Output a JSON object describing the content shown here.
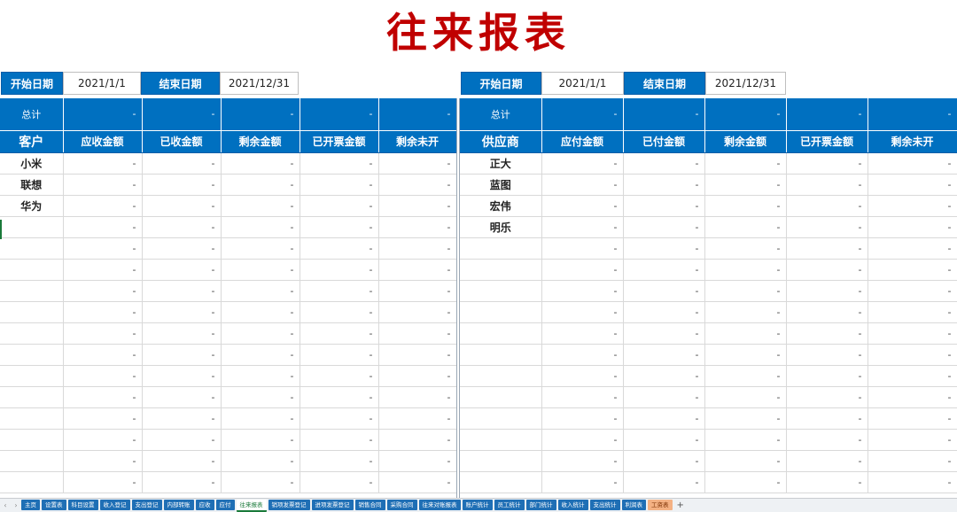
{
  "title": "往来报表",
  "left": {
    "start_label": "开始日期",
    "start_value": "2021/1/1",
    "end_label": "结束日期",
    "end_value": "2021/12/31",
    "total_label": "总计",
    "totals": [
      "-",
      "-",
      "-",
      "-",
      "-"
    ],
    "headers": [
      "客户",
      "应收金额",
      "已收金额",
      "剩余金额",
      "已开票金额",
      "剩余未开"
    ],
    "names": [
      "小米",
      "联想",
      "华为",
      "",
      "",
      "",
      "",
      "",
      "",
      "",
      "",
      "",
      "",
      "",
      "",
      ""
    ],
    "row_values": [
      "-",
      "-",
      "-",
      "-",
      "-"
    ]
  },
  "right": {
    "start_label": "开始日期",
    "start_value": "2021/1/1",
    "end_label": "结束日期",
    "end_value": "2021/12/31",
    "total_label": "总计",
    "totals": [
      "-",
      "-",
      "-",
      "-",
      "-"
    ],
    "headers": [
      "供应商",
      "应付金额",
      "已付金额",
      "剩余金额",
      "已开票金额",
      "剩余未开"
    ],
    "names": [
      "正大",
      "蓝图",
      "宏伟",
      "明乐",
      "",
      "",
      "",
      "",
      "",
      "",
      "",
      "",
      "",
      "",
      "",
      ""
    ],
    "row_values": [
      "-",
      "-",
      "-",
      "-",
      "-"
    ]
  },
  "sheet_tabs": [
    "主页",
    "设置表",
    "科目设置",
    "收入登记",
    "支出登记",
    "内部转账",
    "应收",
    "应付",
    "往来报表",
    "销项发票登记",
    "进项发票登记",
    "销售合同",
    "采购合同",
    "往来对账报表",
    "账户统计",
    "员工统计",
    "部门统计",
    "收入统计",
    "支出统计",
    "利润表",
    "工资表"
  ],
  "active_tab": "往来报表",
  "orange_tab": "工资表",
  "nav_prev": "‹",
  "nav_next": "›",
  "add_sheet": "+"
}
